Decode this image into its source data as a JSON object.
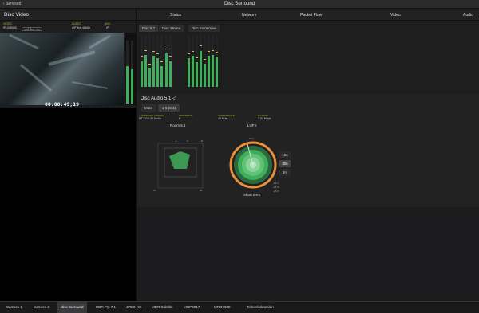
{
  "header": {
    "back_label": "Services",
    "title": "Disc Surround"
  },
  "left": {
    "title": "Disc Video",
    "video_label": "VIDEO",
    "video_value": "IP 1080i50",
    "chips": [
      "SDR",
      "Rec. 709"
    ],
    "audio_label": "AUDIO",
    "audio_value": "• IP 8ch 48kHz",
    "anc_label": "ANC",
    "anc_value": "• IP",
    "timecode": "00:00:49;19"
  },
  "tabs": [
    "Status",
    "Network",
    "Packet Flow",
    "Video",
    "Audio"
  ],
  "audio_tabs": [
    "Disc 5.1",
    "Disc Stereo",
    "Disc Immersive"
  ],
  "audio_meters": {
    "group1": [
      0.5,
      0.62,
      0.35,
      0.6,
      0.55,
      0.4
    ],
    "group2": [
      0.65,
      0.5
    ],
    "group3": [
      0.55,
      0.6,
      0.48,
      0.7,
      0.45,
      0.6,
      0.62,
      0.58
    ]
  },
  "detail": {
    "title": "Disc Audio 5.1",
    "mute_label": "Mute",
    "channel_label": "1-6 (5.1)",
    "transport_format_label": "TRANSPORT FORMAT",
    "transport_format_value": "ST 2110-30 Audio",
    "channels_label": "CHANNELS",
    "channels_value": "6",
    "sample_rate_label": "SAMPLE RATE",
    "sample_rate_value": "48 KHz",
    "bitrate_label": "BITRATE",
    "bitrate_value": "7.34 Mbps"
  },
  "room": {
    "label": "Room 5.1",
    "ch_l": "L",
    "ch_c": "C",
    "ch_r": "R",
    "ch_ls": "Ls",
    "ch_rs": "Rs"
  },
  "loudness": {
    "label": "LUFS",
    "short_term": "Short term",
    "windows": [
      "15s",
      "30s",
      "3m"
    ],
    "selected": "30s",
    "readouts": [
      "-16.3",
      "-26.3",
      "-25.3"
    ],
    "tick_full": "FULL"
  },
  "bottom_tabs": [
    "Camera 1",
    "Camera 2",
    "Disc Surround",
    "HDR PQ 7.1",
    "JPEG XS",
    "MDR Subtitle",
    "MGP2017",
    "MRO7000",
    "Tolmerkskanalen"
  ],
  "bottom_selected": "Disc Surround",
  "colors": {
    "meter": "#3fae5a",
    "accent": "#b6b23a"
  }
}
